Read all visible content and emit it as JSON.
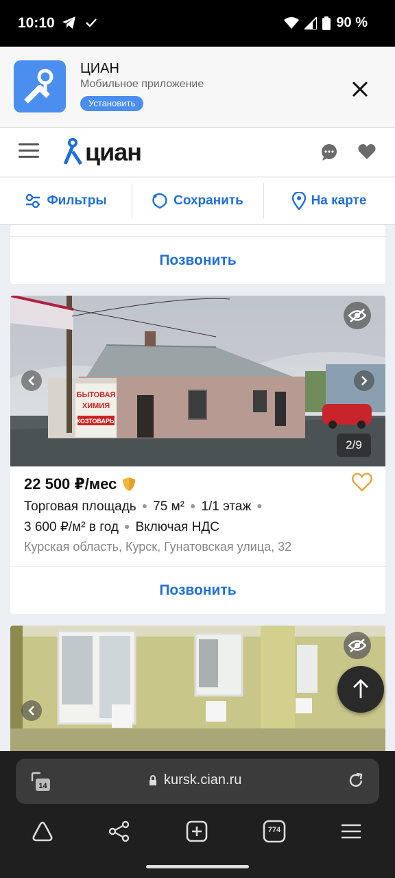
{
  "status_bar": {
    "time": "10:10",
    "battery": "90 %"
  },
  "banner": {
    "title": "ЦИАН",
    "subtitle": "Мобильное приложение",
    "install_label": "Установить"
  },
  "header": {
    "logo_text": "циан"
  },
  "filters": {
    "filters_label": "Фильтры",
    "save_label": "Сохранить",
    "map_label": "На карте"
  },
  "cards": [
    {
      "call_label": "Позвонить"
    },
    {
      "photo_counter": "2/9",
      "price": "22 500 ₽/мес",
      "features_line1": [
        "Торговая площадь",
        "75 м²",
        "1/1 этаж"
      ],
      "features_line2": [
        "3 600 ₽/м² в год",
        "Включая НДС"
      ],
      "address": "Курская область, Курск, Гунатовская улица, 32",
      "call_label": "Позвонить",
      "sign_text": [
        "БЫТОВАЯ",
        "ХИМИЯ",
        "ХОЗТОВАРЫ"
      ]
    }
  ],
  "browser": {
    "url": "kursk.cian.ru",
    "tab_count": "774",
    "tabs_badge": "14"
  },
  "colors": {
    "accent": "#1f6fd9",
    "brand": "#4a8ef0",
    "favorite": "#e8a33a"
  }
}
